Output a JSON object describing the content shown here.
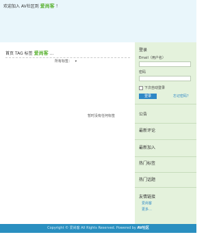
{
  "header": {
    "welcome_prefix": "欢迎加入 AV社区到",
    "welcome_brand": "爱尚客",
    "welcome_suffix": "！"
  },
  "main": {
    "breadcrumb_prefix": "首页 TAG 标签",
    "breadcrumb_brand": "爱尚客",
    "breadcrumb_suffix": "...",
    "filter_label": "所有标签：",
    "filter_caret": "▾",
    "empty_message": "暂时没有任何标签"
  },
  "sidebar": {
    "login_title": "登录",
    "email_label": "Email（用户名）",
    "password_label": "密码",
    "remember_label": "下次自动登录",
    "login_button": "登录",
    "forgot_link": "忘记密码？",
    "sections": [
      {
        "title": "公告"
      },
      {
        "title": "最新评论"
      },
      {
        "title": "最新加入"
      },
      {
        "title": "热门标签"
      },
      {
        "title": "热门话题"
      }
    ],
    "links_title": "友情链接",
    "links": [
      "爱尚客",
      "更多…"
    ]
  },
  "footer": {
    "text": "Copyright © 爱尚客 All Rights Reserved. Powered by",
    "highlight": "AV社区"
  },
  "colors": {
    "header_bg": "#e9f6fb",
    "sidebar_bg": "#e4f2dc",
    "brand_green": "#58b12f",
    "accent_blue": "#2e88c6",
    "footer_bg": "#2a8fc0"
  }
}
